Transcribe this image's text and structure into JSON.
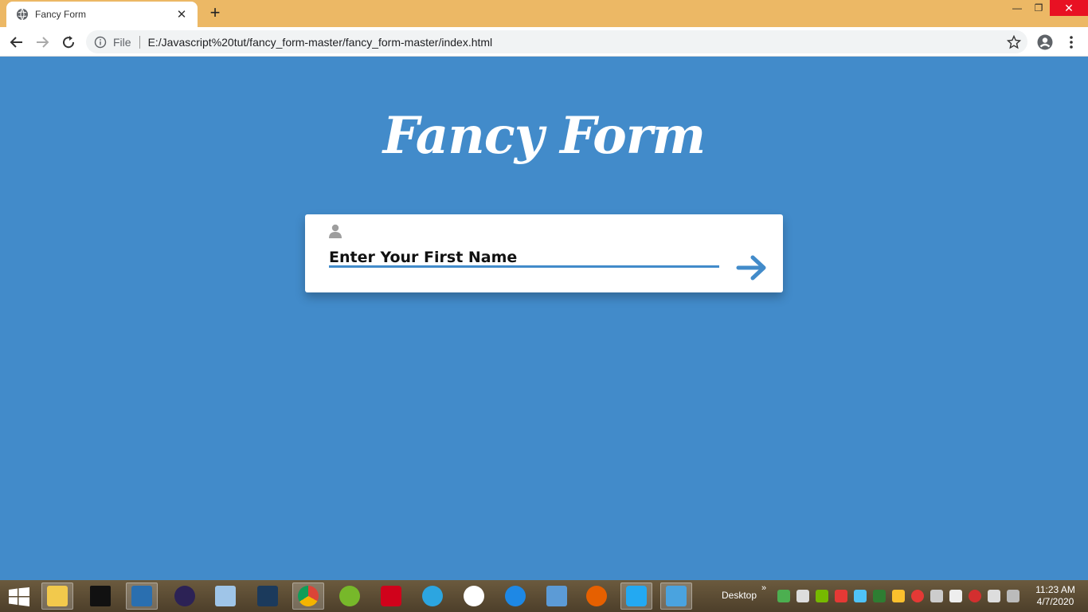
{
  "browser": {
    "tab_title": "Fancy Form",
    "address_prefix": "File",
    "url": "E:/Javascript%20tut/fancy_form-master/fancy_form-master/index.html"
  },
  "page": {
    "title": "Fancy Form",
    "input_label": "Enter Your First Name",
    "accent_color": "#428bca"
  },
  "taskbar": {
    "desktop_label": "Desktop",
    "time": "11:23 AM",
    "date": "4/7/2020",
    "apps": [
      "file-explorer-icon",
      "cmd-icon",
      "brackets-icon",
      "eclipse-icon",
      "notepad-icon",
      "mysql-workbench-icon",
      "chrome-icon",
      "utorrent-icon",
      "download-manager-icon",
      "telegram-icon",
      "slack-icon",
      "sync-icon",
      "remote-desktop-icon",
      "firefox-icon",
      "vscode-icon",
      "photo-viewer-icon"
    ]
  }
}
